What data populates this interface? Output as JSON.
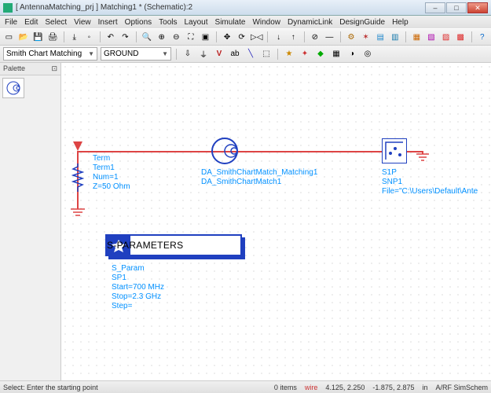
{
  "window": {
    "title": "[ AntennaMatching_prj ] Matching1 * (Schematic):2"
  },
  "menu": [
    "File",
    "Edit",
    "Select",
    "View",
    "Insert",
    "Options",
    "Tools",
    "Layout",
    "Simulate",
    "Window",
    "DynamicLink",
    "DesignGuide",
    "Help"
  ],
  "combo1": "Smith Chart Matching",
  "combo2": "GROUND",
  "palette": {
    "title": "Palette"
  },
  "term": {
    "label": "Term",
    "name": "Term1",
    "num": "Num=1",
    "z": "Z=50 Ohm"
  },
  "da": {
    "line1": "DA_SmithChartMatch_Matching1",
    "line2": "DA_SmithChartMatch1"
  },
  "snp": {
    "label": "S1P",
    "name": "SNP1",
    "file": "File=\"C:\\Users\\Default\\Ante"
  },
  "sparam": {
    "box": "S-PARAMETERS",
    "label": "S_Param",
    "name": "SP1",
    "start": "Start=700 MHz",
    "stop": "Stop=2.3 GHz",
    "step": "Step="
  },
  "status": {
    "hint": "Select: Enter the starting point",
    "items": "0 items",
    "mode": "wire",
    "c1": "4.125, 2.250",
    "c2": "-1.875, 2.875",
    "in": "in",
    "ctx": "A/RF SimSchem"
  }
}
